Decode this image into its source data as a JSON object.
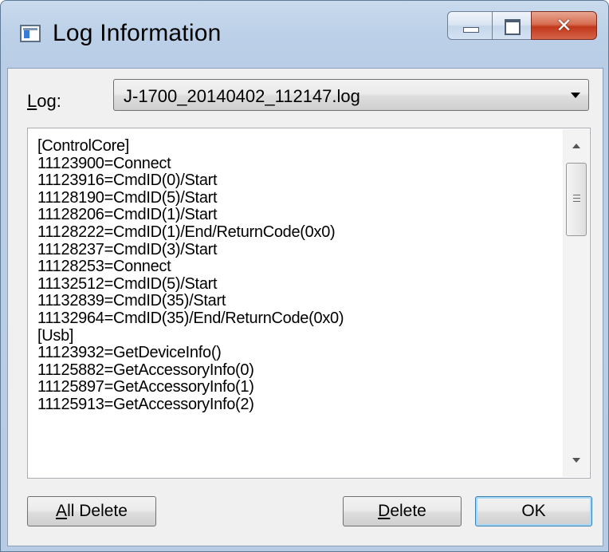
{
  "window": {
    "title": "Log Information",
    "icon": "application-window-icon",
    "controls": [
      "minimize-icon",
      "maximize-icon",
      "close-icon"
    ]
  },
  "log_selector": {
    "label_underlined": "L",
    "label_rest": "og:",
    "selected_value": "J-1700_20140402_112147.log"
  },
  "log_content": {
    "lines": [
      "[ControlCore]",
      "11123900=Connect",
      "11123916=CmdID(0)/Start",
      "11128190=CmdID(5)/Start",
      "11128206=CmdID(1)/Start",
      "11128222=CmdID(1)/End/ReturnCode(0x0)",
      "11128237=CmdID(3)/Start",
      "11128253=Connect",
      "11132512=CmdID(5)/Start",
      "11132839=CmdID(35)/Start",
      "11132964=CmdID(35)/End/ReturnCode(0x0)",
      "[Usb]",
      "11123932=GetDeviceInfo()",
      "11125882=GetAccessoryInfo(0)",
      "11125897=GetAccessoryInfo(1)",
      "11125913=GetAccessoryInfo(2)"
    ]
  },
  "buttons": {
    "all_delete_underlined": "A",
    "all_delete_rest": "ll Delete",
    "delete_underlined": "D",
    "delete_rest": "elete",
    "ok": "OK"
  }
}
